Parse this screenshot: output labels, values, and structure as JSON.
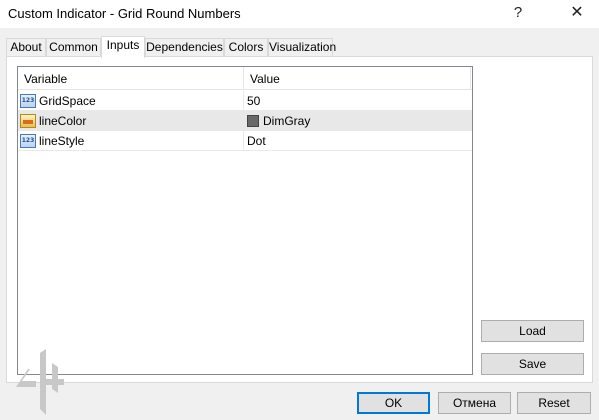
{
  "window": {
    "title": "Custom Indicator - Grid Round Numbers",
    "help_label": "?",
    "close_label": "✕"
  },
  "tabs": [
    {
      "label": "About",
      "active": false
    },
    {
      "label": "Common",
      "active": false
    },
    {
      "label": "Inputs",
      "active": true
    },
    {
      "label": "Dependencies",
      "active": false
    },
    {
      "label": "Colors",
      "active": false
    },
    {
      "label": "Visualization",
      "active": false
    }
  ],
  "inputs_table": {
    "columns": [
      "Variable",
      "Value"
    ],
    "rows": [
      {
        "variable": "GridSpace",
        "value": "50",
        "icon": "numeric-param-icon",
        "icon_text": "123"
      },
      {
        "variable": "lineColor",
        "value": "DimGray",
        "icon": "color-param-icon",
        "swatch_color": "#696969",
        "selected": true
      },
      {
        "variable": "lineStyle",
        "value": "Dot",
        "icon": "numeric-param-icon",
        "icon_text": "123"
      }
    ]
  },
  "side_buttons": {
    "load": "Load",
    "save": "Save"
  },
  "footer_buttons": {
    "ok": "OK",
    "cancel": "Отмена",
    "reset": "Reset"
  },
  "colors": {
    "accent": "#0078d7",
    "selected_row": "#e8e8e8",
    "swatch": "#696969"
  }
}
